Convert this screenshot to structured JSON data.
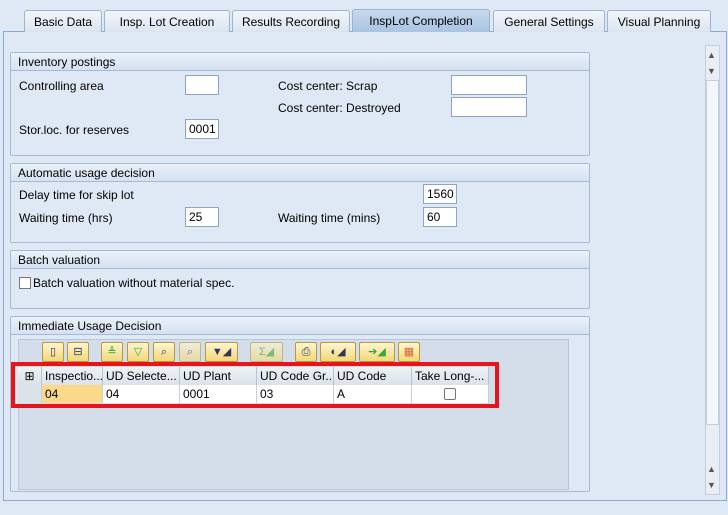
{
  "tabs": [
    {
      "label": "Basic Data"
    },
    {
      "label": "Insp. Lot Creation"
    },
    {
      "label": "Results Recording"
    },
    {
      "label": "InspLot Completion",
      "active": true
    },
    {
      "label": "General Settings"
    },
    {
      "label": "Visual Planning"
    }
  ],
  "inventory": {
    "title": "Inventory postings",
    "controlling_area_label": "Controlling area",
    "controlling_area_value": "",
    "cc_scrap_label": "Cost center: Scrap",
    "cc_scrap_value": "",
    "cc_destroyed_label": "Cost center: Destroyed",
    "cc_destroyed_value": "",
    "storloc_label": "Stor.loc. for reserves",
    "storloc_value": "0001"
  },
  "auto_ud": {
    "title": "Automatic usage decision",
    "delay_label": "Delay time for skip lot",
    "delay_value": "1560",
    "wait_hrs_label": "Waiting time (hrs)",
    "wait_hrs_value": "25",
    "wait_mins_label": "Waiting time (mins)",
    "wait_mins_value": "60"
  },
  "batch": {
    "title": "Batch valuation",
    "checkbox_label": "Batch valuation without material spec.",
    "checked": false
  },
  "immediate": {
    "title": "Immediate Usage Decision",
    "toolbar": [
      "new-icon",
      "delete-row-icon",
      "sort-asc-icon",
      "sort-desc-icon",
      "find-icon",
      "find-next-icon",
      "filter-icon",
      "sum-icon",
      "print-icon",
      "views-icon",
      "export-icon",
      "layout-icon"
    ],
    "columns": [
      "Inspectio...",
      "UD Selecte...",
      "UD Plant",
      "UD Code Gr...",
      "UD Code",
      "Take Long-..."
    ],
    "rows": [
      [
        "04",
        "04",
        "0001",
        "03",
        "A",
        ""
      ]
    ]
  },
  "colors": {
    "highlight": "#e8141c",
    "accent": "#a9c4e2"
  }
}
